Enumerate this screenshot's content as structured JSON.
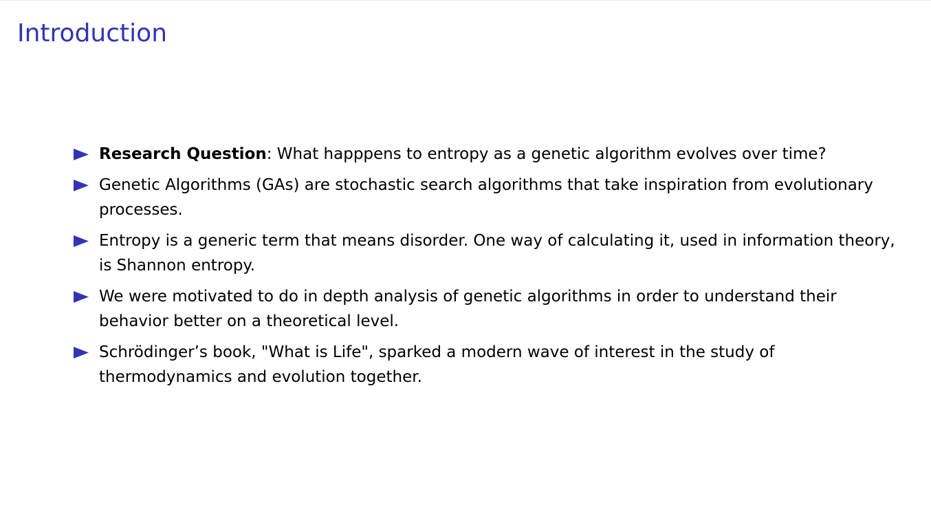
{
  "slide": {
    "title": "Introduction",
    "accent_color": "#3333b3",
    "bullet_icon": "triangle-right-icon",
    "bullets": [
      {
        "strong": "Research Question",
        "text": ": What happpens to entropy as a genetic algorithm evolves over time?"
      },
      {
        "strong": "",
        "text": "Genetic Algorithms (GAs) are stochastic search algorithms that take inspiration from evolutionary processes."
      },
      {
        "strong": "",
        "text": "Entropy is a generic term that means disorder.  One way of calculating it, used in information theory, is Shannon entropy."
      },
      {
        "strong": "",
        "text": "We were motivated to do in depth analysis of genetic algorithms in order to understand their behavior better on a theoretical level."
      },
      {
        "strong": "",
        "text": "Schrödinger’s book, \"What is Life\", sparked a modern wave of interest in the study of thermodynamics and evolution together."
      }
    ]
  }
}
